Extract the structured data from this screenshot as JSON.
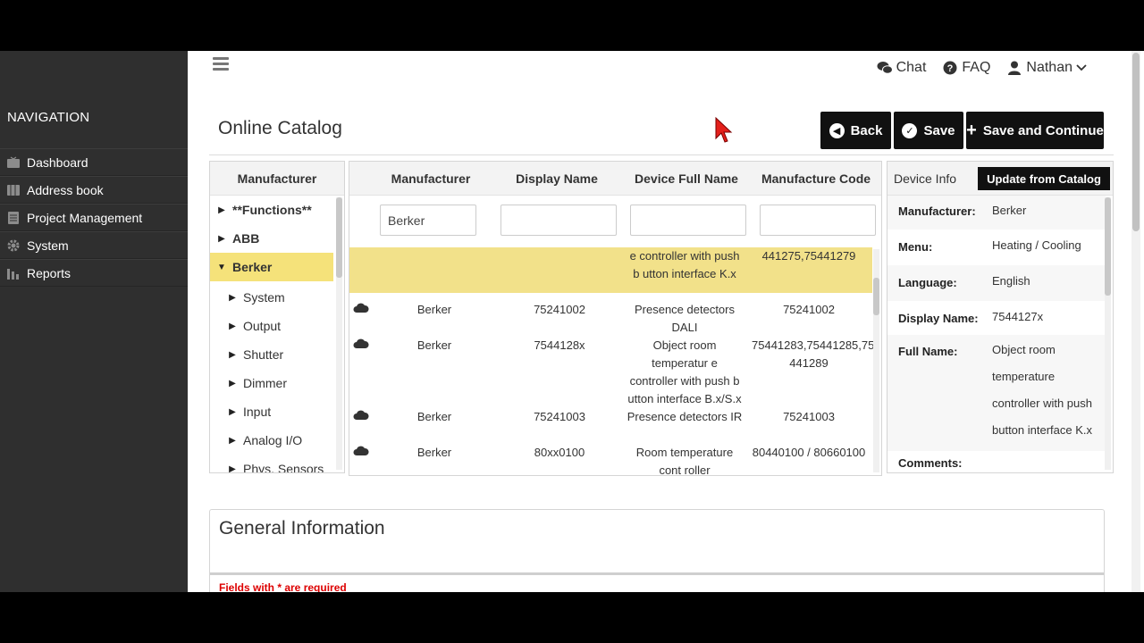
{
  "sidebar": {
    "title": "NAVIGATION",
    "items": [
      {
        "label": "Dashboard",
        "icon": "tv-icon"
      },
      {
        "label": "Address book",
        "icon": "address-book-icon"
      },
      {
        "label": "Project Management",
        "icon": "clipboard-icon"
      },
      {
        "label": "System",
        "icon": "gear-icon"
      },
      {
        "label": "Reports",
        "icon": "bar-chart-icon"
      }
    ]
  },
  "topnav": {
    "chat": "Chat",
    "faq": "FAQ",
    "user": "Nathan"
  },
  "page": {
    "title": "Online Catalog",
    "buttons": {
      "back": "Back",
      "save": "Save",
      "save_continue": "Save and Continue"
    }
  },
  "tree": {
    "header": "Manufacturer",
    "items": [
      {
        "label": "**Functions**",
        "level": 1
      },
      {
        "label": "ABB",
        "level": 1
      },
      {
        "label": "Berker",
        "level": 1,
        "selected": true,
        "expanded": true
      },
      {
        "label": "System",
        "level": 2
      },
      {
        "label": "Output",
        "level": 2
      },
      {
        "label": "Shutter",
        "level": 2
      },
      {
        "label": "Dimmer",
        "level": 2
      },
      {
        "label": "Input",
        "level": 2
      },
      {
        "label": "Analog I/O",
        "level": 2
      },
      {
        "label": "Phys. Sensors",
        "level": 2
      }
    ]
  },
  "grid": {
    "headers": {
      "manufacturer": "Manufacturer",
      "display_name": "Display Name",
      "full_name": "Device Full Name",
      "code": "Manufacture Code"
    },
    "filters": {
      "manufacturer": "Berker",
      "display_name": "",
      "full_name": "",
      "code": ""
    },
    "rows": [
      {
        "manufacturer": "",
        "display": "",
        "full_name": "e controller with push b utton interface K.x",
        "code": "441275,75441279",
        "selected": true,
        "cloud": false
      },
      {
        "manufacturer": "Berker",
        "display": "75241002",
        "full_name": "Presence detectors DALI",
        "code": "75241002",
        "cloud": true
      },
      {
        "manufacturer": "Berker",
        "display": "7544128x",
        "full_name": "Object room temperatur e controller with push b utton interface B.x/S.x",
        "code": "75441283,75441285,75 441289",
        "cloud": true
      },
      {
        "manufacturer": "Berker",
        "display": "75241003",
        "full_name": "Presence detectors IR",
        "code": "75241003",
        "cloud": true
      },
      {
        "manufacturer": "Berker",
        "display": "80xx0100",
        "full_name": "Room temperature cont roller",
        "code": "80440100 / 80660100",
        "cloud": true
      }
    ]
  },
  "device_info": {
    "title": "Device Info",
    "update_button": "Update from Catalog",
    "fields": {
      "manufacturer": {
        "key": "Manufacturer:",
        "value": "Berker"
      },
      "menu": {
        "key": "Menu:",
        "value": "Heating / Cooling"
      },
      "language": {
        "key": "Language:",
        "value": "English"
      },
      "display_name": {
        "key": "Display Name:",
        "value": "7544127x"
      },
      "full_name": {
        "key": "Full Name:",
        "value": "Object room temperature controller with push button interface K.x"
      },
      "comments": {
        "key": "Comments:",
        "value": ""
      }
    }
  },
  "general": {
    "title": "General Information",
    "required_note": "Fields with * are required"
  },
  "colors": {
    "sidebar_bg": "#2f2f2f",
    "selected_row": "#f2e18a",
    "button_bg": "#111111",
    "required_text": "#dd0000"
  }
}
